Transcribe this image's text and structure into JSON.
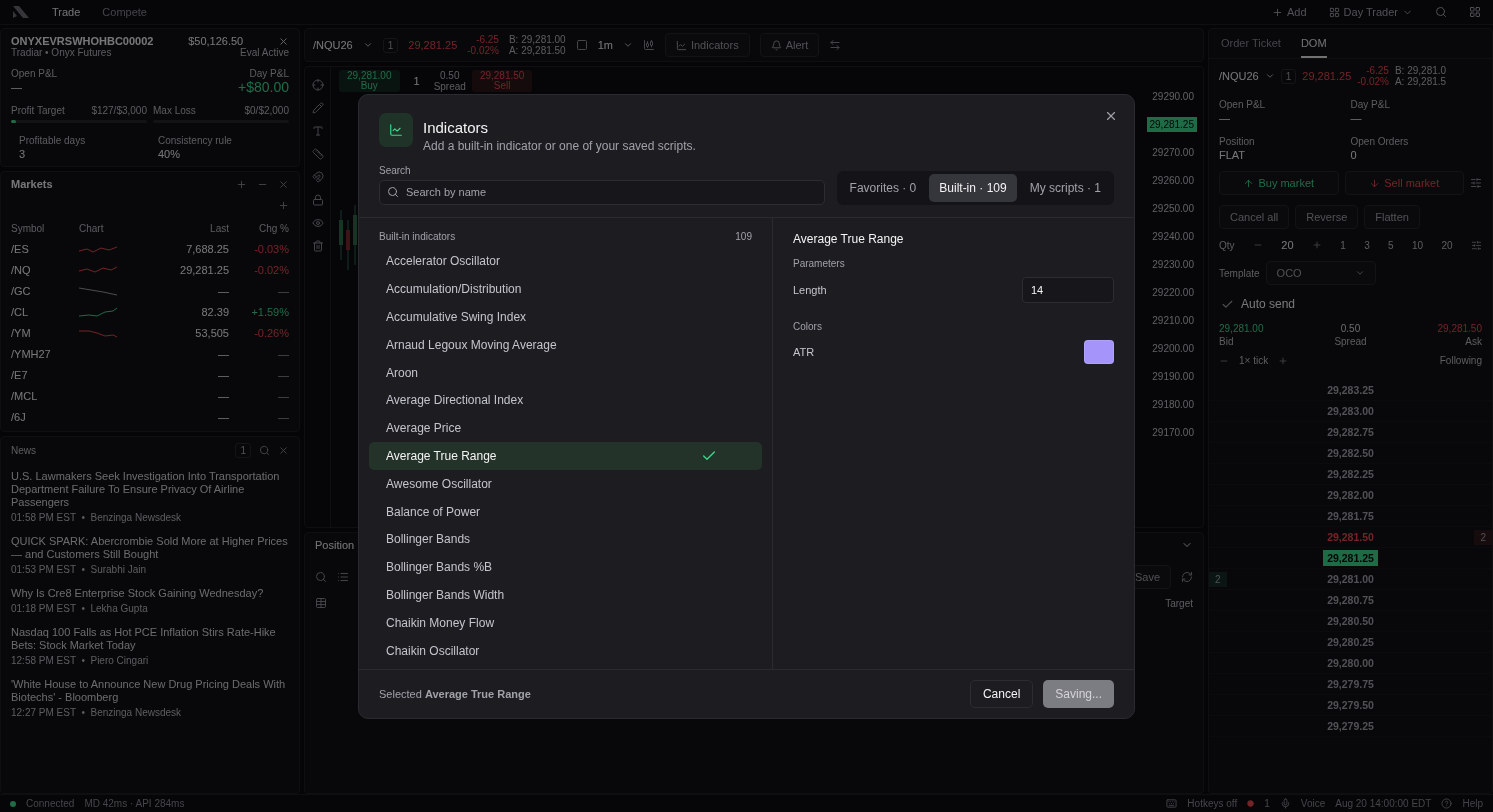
{
  "topbar": {
    "nav": [
      {
        "label": "Trade",
        "selected": true
      },
      {
        "label": "Compete",
        "selected": false
      }
    ],
    "add": "Add",
    "layout": "Day Trader"
  },
  "account": {
    "id": "ONYXEVRSWHOHBC00002",
    "firm": "Tradiar • Onyx Futures",
    "balance": "$50,126.50",
    "status": "Eval Active",
    "open_pnl_label": "Open P&L",
    "open_pnl": "—",
    "day_pnl_label": "Day P&L",
    "day_pnl": "+$80.00",
    "limits": [
      {
        "label": "Profit Target",
        "value": "$127/$3,000",
        "level": 0.04
      },
      {
        "label": "Max Loss",
        "value": "$0/$2,000"
      }
    ],
    "stats": [
      {
        "label": "Profitable days",
        "value": "3"
      },
      {
        "label": "Consistency rule",
        "value": "40%"
      }
    ]
  },
  "markets": {
    "title": "Markets",
    "columns": [
      "Symbol",
      "Chart",
      "Last",
      "Chg %"
    ],
    "rows": [
      {
        "symbol": "/ES",
        "last": "7,688.25",
        "change": "-0.03%",
        "kind": "down"
      },
      {
        "symbol": "/NQ",
        "last": "29,281.25",
        "change": "-0.02%",
        "kind": "down"
      },
      {
        "symbol": "/GC",
        "last": "—",
        "change": "—",
        "kind": "flat"
      },
      {
        "symbol": "/CL",
        "last": "82.39",
        "change": "+1.59%",
        "kind": "up"
      },
      {
        "symbol": "/YM",
        "last": "53,505",
        "change": "-0.26%",
        "kind": "down"
      },
      {
        "symbol": "/YMH27",
        "last": "—",
        "change": "—",
        "kind": "none"
      },
      {
        "symbol": "/E7",
        "last": "—",
        "change": "—",
        "kind": "none"
      },
      {
        "symbol": "/MCL",
        "last": "—",
        "change": "—",
        "kind": "none"
      },
      {
        "symbol": "/6J",
        "last": "—",
        "change": "—",
        "kind": "none"
      }
    ]
  },
  "news": {
    "title": "News",
    "count": "1",
    "items": [
      {
        "headline": "U.S. Lawmakers Seek Investigation Into Transportation Department Failure To Ensure Privacy Of Airline Passengers",
        "meta": "01:58 PM EST  •  Benzinga Newsdesk"
      },
      {
        "headline": "QUICK SPARK: Abercrombie Sold More at Higher Prices — and Customers Still Bought",
        "meta": "01:53 PM EST  •  Surabhi Jain"
      },
      {
        "headline": "Why Is Cre8 Enterprise Stock Gaining Wednesday?",
        "meta": "01:18 PM EST  •  Lekha Gupta"
      },
      {
        "headline": "Nasdaq 100 Falls as Hot PCE Inflation Stirs Rate-Hike Bets: Stock Market Today",
        "meta": "12:58 PM EST  •  Piero Cingari"
      },
      {
        "headline": "'White House to Announce New Drug Pricing Deals With Biotechs' - Bloomberg",
        "meta": "12:27 PM EST  •  Benzinga Newsdesk"
      }
    ]
  },
  "chart": {
    "symbol": "/NQU26",
    "qty": "1",
    "price": "29,281.25",
    "change": "-6.25",
    "change_pct": "-0.02%",
    "bid": "B: 29,281.00",
    "ask": "A: 29,281.50",
    "interval": "1m",
    "indicators": "Indicators",
    "alert": "Alert",
    "quick": {
      "buy_price": "29,281.00",
      "buy_label": "Buy",
      "qty": "1",
      "spread": "0.50",
      "spread_label": "Spread",
      "sell_price": "29,281.50",
      "sell_label": "Sell"
    },
    "axis": [
      {
        "price": "29290.00",
        "current": false
      },
      {
        "price": "29,281.25",
        "current": true
      },
      {
        "price": "29270.00",
        "current": false
      },
      {
        "price": "29260.00",
        "current": false
      },
      {
        "price": "29250.00",
        "current": false
      },
      {
        "price": "29240.00",
        "current": false
      },
      {
        "price": "29230.00",
        "current": false
      },
      {
        "price": "29220.00",
        "current": false
      },
      {
        "price": "29210.00",
        "current": false
      },
      {
        "price": "29200.00",
        "current": false
      },
      {
        "price": "29190.00",
        "current": false
      },
      {
        "price": "29180.00",
        "current": false
      },
      {
        "price": "29170.00",
        "current": false
      }
    ]
  },
  "positions": {
    "title": "Position",
    "save": "Save",
    "column": "Target"
  },
  "ticket": {
    "tabs": [
      {
        "label": "Order Ticket",
        "selected": false
      },
      {
        "label": "DOM",
        "selected": true
      }
    ],
    "symbol": "/NQU26",
    "qty": "1",
    "price": "29,281.25",
    "change": "-6.25",
    "change_pct": "-0.02%",
    "bid": "B: 29,281.0",
    "ask": "A: 29,281.5",
    "fields": [
      {
        "label": "Open P&L",
        "value": "—"
      },
      {
        "label": "Day P&L",
        "value": "—"
      },
      {
        "label": "Position",
        "value": "FLAT"
      },
      {
        "label": "Open Orders",
        "value": "0"
      }
    ],
    "buy": "Buy market",
    "sell": "Sell market",
    "actions": [
      "Cancel all",
      "Reverse",
      "Flatten"
    ],
    "qty_label": "Qty",
    "qty_value": "20",
    "presets": [
      "1",
      "3",
      "5",
      "10",
      "20"
    ],
    "template_label": "Template",
    "template": "OCO",
    "auto_send": {
      "label": "Auto send",
      "checked": true
    },
    "bid_price": "29,281.00",
    "bid_label": "Bid",
    "spread": "0.50",
    "spread_label": "Spread",
    "ask_price": "29,281.50",
    "ask_label": "Ask",
    "tick": "1× tick",
    "following": "Following",
    "ladder": [
      {
        "price": "29,283.25",
        "kind": "plain"
      },
      {
        "price": "29,283.00",
        "kind": "plain"
      },
      {
        "price": "29,282.75",
        "kind": "plain"
      },
      {
        "price": "29,282.50",
        "kind": "plain"
      },
      {
        "price": "29,282.25",
        "kind": "plain"
      },
      {
        "price": "29,282.00",
        "kind": "plain"
      },
      {
        "price": "29,281.75",
        "kind": "plain"
      },
      {
        "price": "29,281.50",
        "kind": "ask",
        "size": "2"
      },
      {
        "price": "29,281.25",
        "kind": "last"
      },
      {
        "price": "29,281.00",
        "kind": "bid",
        "size": "2"
      },
      {
        "price": "29,280.75",
        "kind": "plain"
      },
      {
        "price": "29,280.50",
        "kind": "plain"
      },
      {
        "price": "29,280.25",
        "kind": "plain"
      },
      {
        "price": "29,280.00",
        "kind": "plain"
      },
      {
        "price": "29,279.75",
        "kind": "plain"
      },
      {
        "price": "29,279.50",
        "kind": "plain"
      },
      {
        "price": "29,279.25",
        "kind": "plain"
      }
    ]
  },
  "status_bar": {
    "connection": "Connected",
    "latency": "MD 42ms · API 284ms",
    "hotkeys": "Hotkeys off",
    "alerts": "1",
    "voice": "Voice",
    "clock": "Aug 20 14:00:00 EDT",
    "help": "Help"
  },
  "dialog": {
    "title": "Indicators",
    "subtitle": "Add a built-in indicator or one of your saved scripts.",
    "search_label": "Search",
    "search_placeholder": "Search by name",
    "filters": [
      {
        "label": "Favorites · 0",
        "selected": false
      },
      {
        "label": "Built-in · 109",
        "selected": true
      },
      {
        "label": "My scripts · 1",
        "selected": false
      }
    ],
    "list_title": "Built-in indicators",
    "list_count": "109",
    "indicators": [
      {
        "name": "Accelerator Oscillator",
        "selected": false
      },
      {
        "name": "Accumulation/Distribution",
        "selected": false
      },
      {
        "name": "Accumulative Swing Index",
        "selected": false
      },
      {
        "name": "Arnaud Legoux Moving Average",
        "selected": false
      },
      {
        "name": "Aroon",
        "selected": false
      },
      {
        "name": "Average Directional Index",
        "selected": false
      },
      {
        "name": "Average Price",
        "selected": false
      },
      {
        "name": "Average True Range",
        "selected": true
      },
      {
        "name": "Awesome Oscillator",
        "selected": false
      },
      {
        "name": "Balance of Power",
        "selected": false
      },
      {
        "name": "Bollinger Bands",
        "selected": false
      },
      {
        "name": "Bollinger Bands %B",
        "selected": false
      },
      {
        "name": "Bollinger Bands Width",
        "selected": false
      },
      {
        "name": "Chaikin Money Flow",
        "selected": false
      },
      {
        "name": "Chaikin Oscillator",
        "selected": false
      }
    ],
    "detail": {
      "title": "Average True Range",
      "parameters_label": "Parameters",
      "parameters": [
        {
          "label": "Length",
          "value": "14"
        }
      ],
      "colors_label": "Colors",
      "colors": [
        {
          "label": "ATR",
          "color": "#a594f9"
        }
      ]
    },
    "footer": "Selected **Average True Range**",
    "cancel": "Cancel",
    "submit": "Saving..."
  }
}
